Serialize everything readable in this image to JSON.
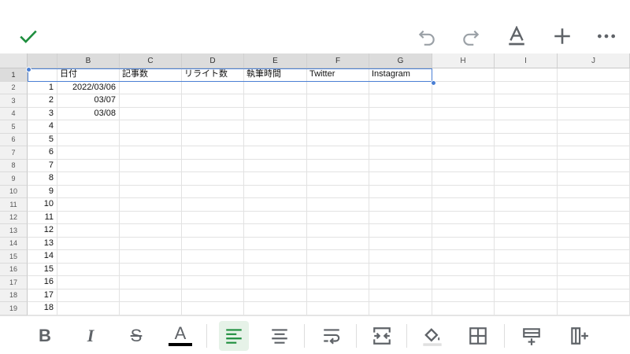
{
  "toolbar": {
    "icons": [
      "check-icon",
      "undo-icon",
      "redo-icon",
      "text-format-icon",
      "plus-icon",
      "more-icon"
    ],
    "accent": "#1e8e3e"
  },
  "grid": {
    "columns": [
      "",
      "B",
      "C",
      "D",
      "E",
      "F",
      "G",
      "H",
      "I",
      "J"
    ],
    "rows": [
      {
        "num": "1",
        "cells": [
          "",
          "日付",
          "記事数",
          "リライト数",
          "執筆時間",
          "Twitter",
          "Instagram"
        ]
      },
      {
        "num": "2",
        "cells": [
          "1",
          "2022/03/06"
        ]
      },
      {
        "num": "3",
        "cells": [
          "2",
          "03/07"
        ]
      },
      {
        "num": "4",
        "cells": [
          "3",
          "03/08"
        ]
      },
      {
        "num": "5",
        "cells": [
          "4"
        ]
      },
      {
        "num": "6",
        "cells": [
          "5"
        ]
      },
      {
        "num": "7",
        "cells": [
          "6"
        ]
      },
      {
        "num": "8",
        "cells": [
          "7"
        ]
      },
      {
        "num": "9",
        "cells": [
          "8"
        ]
      },
      {
        "num": "10",
        "cells": [
          "9"
        ]
      },
      {
        "num": "11",
        "cells": [
          "10"
        ]
      },
      {
        "num": "12",
        "cells": [
          "11"
        ]
      },
      {
        "num": "13",
        "cells": [
          "12"
        ]
      },
      {
        "num": "14",
        "cells": [
          "13"
        ]
      },
      {
        "num": "15",
        "cells": [
          "14"
        ]
      },
      {
        "num": "16",
        "cells": [
          "15"
        ]
      },
      {
        "num": "17",
        "cells": [
          "16"
        ]
      },
      {
        "num": "18",
        "cells": [
          "17"
        ]
      },
      {
        "num": "19",
        "cells": [
          "18"
        ]
      }
    ],
    "selection_color": "#4a7fd4"
  },
  "format_bar": {
    "bold": "B",
    "italic": "I",
    "strike": "S",
    "text_color": "A",
    "text_color_swatch": "#000000",
    "active_color": "#1e8e3e"
  }
}
